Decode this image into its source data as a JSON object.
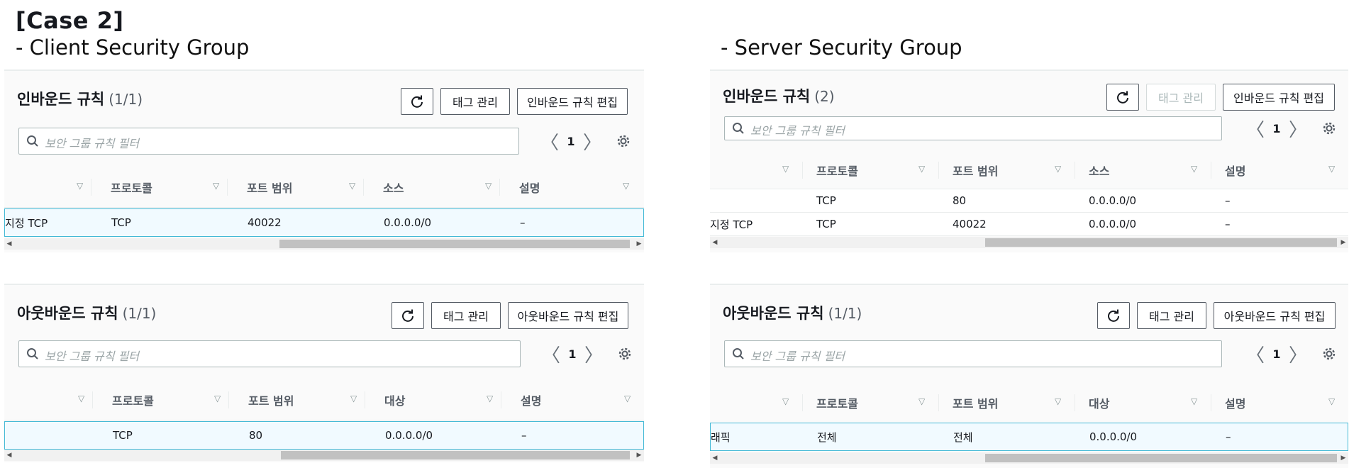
{
  "case_title": "[Case 2]",
  "client_group_title": "- Client Security Group",
  "server_group_title": "- Server Security Group",
  "common": {
    "refresh_icon": "refresh-icon",
    "tag_btn": "태그 관리",
    "search_placeholder": "보안 그룹 규칙 필터",
    "page": "1",
    "prev": "〈",
    "next": "〉"
  },
  "client_inbound": {
    "title": "인바운드 규칙",
    "count": "(1/1)",
    "edit_btn": "인바운드 규칙 편집",
    "columns": [
      "",
      "프로토콜",
      "포트 범위",
      "소스",
      "설명"
    ],
    "rows": [
      [
        "지정 TCP",
        "TCP",
        "40022",
        "0.0.0.0/0",
        "–"
      ]
    ]
  },
  "client_outbound": {
    "title": "아웃바운드 규칙",
    "count": "(1/1)",
    "edit_btn": "아웃바운드 규칙 편집",
    "columns": [
      "",
      "프로토콜",
      "포트 범위",
      "대상",
      "설명"
    ],
    "rows": [
      [
        "",
        "TCP",
        "80",
        "0.0.0.0/0",
        "–"
      ]
    ]
  },
  "server_inbound": {
    "title": "인바운드 규칙",
    "count": "(2)",
    "edit_btn": "인바운드 규칙 편집",
    "columns": [
      "",
      "프로토콜",
      "포트 범위",
      "소스",
      "설명"
    ],
    "rows": [
      [
        "",
        "TCP",
        "80",
        "0.0.0.0/0",
        "–"
      ],
      [
        "지정 TCP",
        "TCP",
        "40022",
        "0.0.0.0/0",
        "–"
      ]
    ]
  },
  "server_outbound": {
    "title": "아웃바운드 규칙",
    "count": "(1/1)",
    "edit_btn": "아웃바운드 규칙 편집",
    "columns": [
      "",
      "프로토콜",
      "포트 범위",
      "대상",
      "설명"
    ],
    "rows": [
      [
        "래픽",
        "전체",
        "전체",
        "0.0.0.0/0",
        "–"
      ]
    ]
  }
}
